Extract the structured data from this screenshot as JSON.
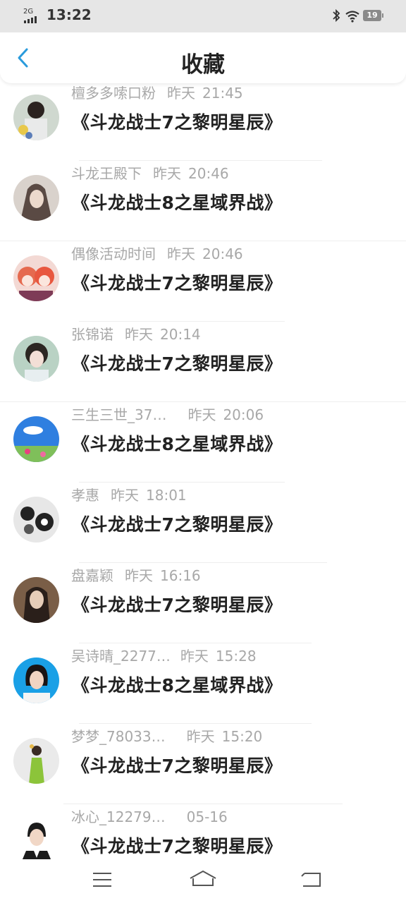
{
  "status_bar": {
    "network": "2G",
    "time": "13:22",
    "battery": "19"
  },
  "header": {
    "title": "收藏"
  },
  "items": [
    {
      "user": "檀多多嗦口粉",
      "date": "昨天",
      "time": "21:45",
      "title": "《斗龙战士7之黎明星辰》"
    },
    {
      "user": "斗龙王殿下",
      "date": "昨天",
      "time": "20:46",
      "title": "《斗龙战士8之星域界战》"
    },
    {
      "user": "偶像活动时间",
      "date": "昨天",
      "time": "20:46",
      "title": "《斗龙战士7之黎明星辰》"
    },
    {
      "user": "张锦诺",
      "date": "昨天",
      "time": "20:14",
      "title": "《斗龙战士7之黎明星辰》"
    },
    {
      "user": "三生三世_37…",
      "date": "昨天",
      "time": "20:06",
      "title": "《斗龙战士8之星域界战》"
    },
    {
      "user": "孝惠",
      "date": "昨天",
      "time": "18:01",
      "title": "《斗龙战士7之黎明星辰》"
    },
    {
      "user": "盘嘉颖",
      "date": "昨天",
      "time": "16:16",
      "title": "《斗龙战士7之黎明星辰》"
    },
    {
      "user": "吴诗晴_2277…",
      "date": "昨天",
      "time": "15:28",
      "title": "《斗龙战士8之星域界战》"
    },
    {
      "user": "梦梦_78033…",
      "date": "昨天",
      "time": "15:20",
      "title": "《斗龙战士7之黎明星辰》"
    },
    {
      "user": "冰心_12279…",
      "date": "05-16",
      "time": "",
      "title": "《斗龙战士7之黎明星辰》"
    }
  ],
  "colors": {
    "accent": "#2a9bdc",
    "meta_text": "#a8a8a8",
    "title_text": "#222222"
  },
  "icons": {
    "back": "chevron-left-icon",
    "menu": "menu-icon",
    "home": "home-icon",
    "return": "return-icon"
  }
}
